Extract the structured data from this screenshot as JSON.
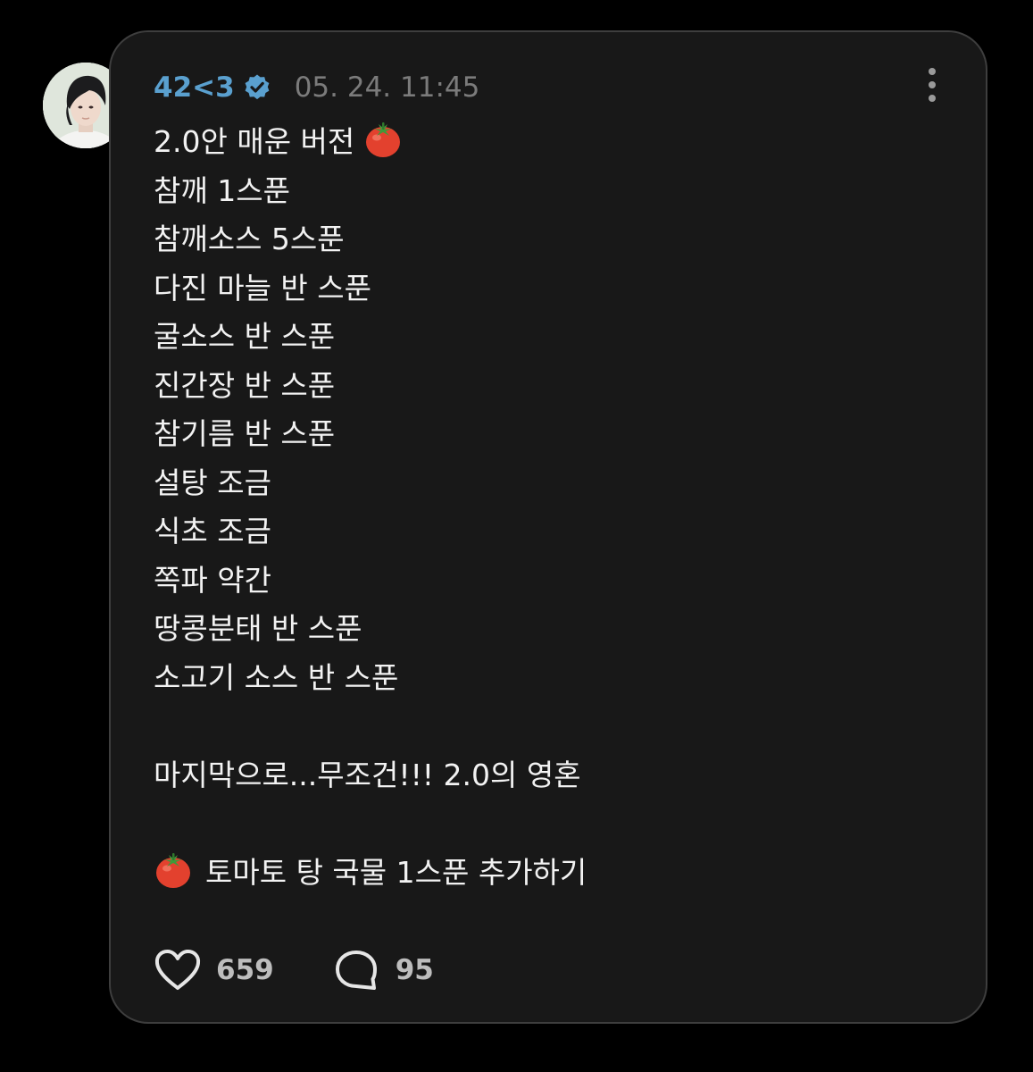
{
  "post": {
    "author": {
      "username": "42<3",
      "verified": true,
      "avatar_icon": "profile-photo"
    },
    "timestamp": "05. 24. 11:45",
    "more_icon": "vertical-ellipsis-icon",
    "title": "2.0안 매운 버전",
    "title_emoji": "tomato",
    "ingredients": [
      "참깨 1스푼",
      "참깨소스 5스푼",
      "다진 마늘 반 스푼",
      "굴소스 반 스푼",
      "진간장 반 스푼",
      "참기름 반 스푼",
      "설탕 조금",
      "식초 조금",
      "쪽파 약간",
      "땅콩분태 반 스푼",
      "소고기 소스 반 스푼"
    ],
    "closing_line": "마지막으로...무조건!!! 2.0의 영혼",
    "final_step": "토마토 탕 국물 1스푼 추가하기",
    "final_emoji": "tomato"
  },
  "actions": {
    "likes": "659",
    "comments": "95",
    "like_icon": "heart-outline-icon",
    "comment_icon": "speech-bubble-icon"
  },
  "colors": {
    "background": "#000000",
    "card": "#181818",
    "card_border": "#3e3e3e",
    "username": "#5aa0cf",
    "verified_badge": "#5aa0cf",
    "timestamp": "#7b7b7b",
    "body_text": "#f2f2f2",
    "counts": "#bdbdbd"
  }
}
